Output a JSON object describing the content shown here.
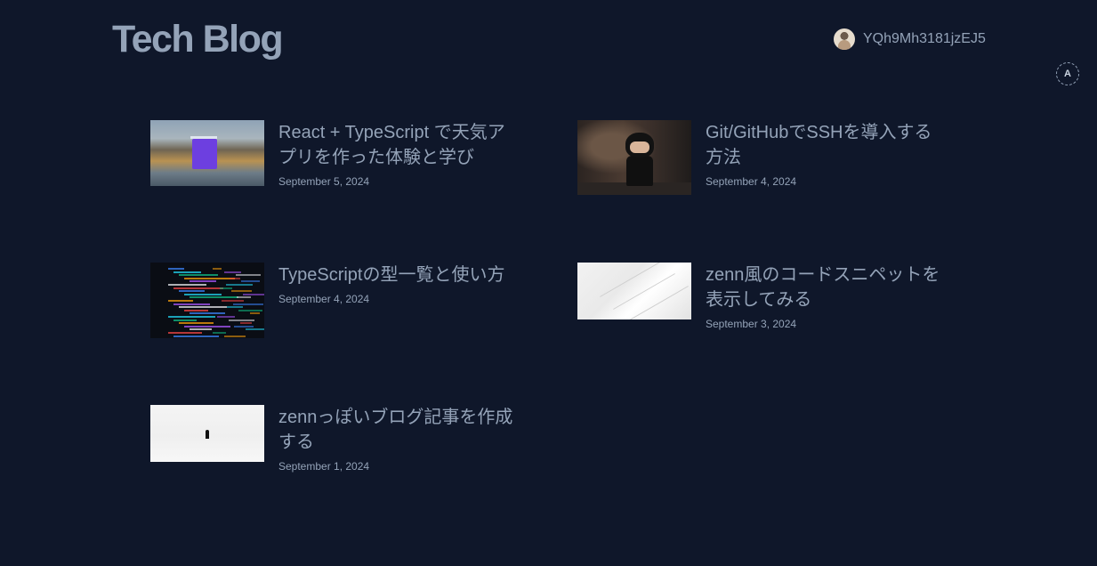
{
  "header": {
    "site_title": "Tech Blog",
    "username": "YQh9Mh3181jzEJ5",
    "a11y_label": "A"
  },
  "posts": [
    {
      "title": "React + TypeScript で天気アプリを作った体験と学び",
      "date": "September 5, 2024",
      "thumbnail_icon": "weather-app-screenshot"
    },
    {
      "title": "Git/GitHubでSSHを導入する方法",
      "date": "September 4, 2024",
      "thumbnail_icon": "octocat-figure"
    },
    {
      "title": "TypeScriptの型一覧と使い方",
      "date": "September 4, 2024",
      "thumbnail_icon": "code-screen"
    },
    {
      "title": "zenn風のコードスニペットを表示してみる",
      "date": "September 3, 2024",
      "thumbnail_icon": "white-stairs"
    },
    {
      "title": "zennっぽいブログ記事を作成する",
      "date": "September 1, 2024",
      "thumbnail_icon": "person-in-snow"
    }
  ],
  "colors": {
    "background": "#0f172a",
    "text": "#94a3b8"
  }
}
